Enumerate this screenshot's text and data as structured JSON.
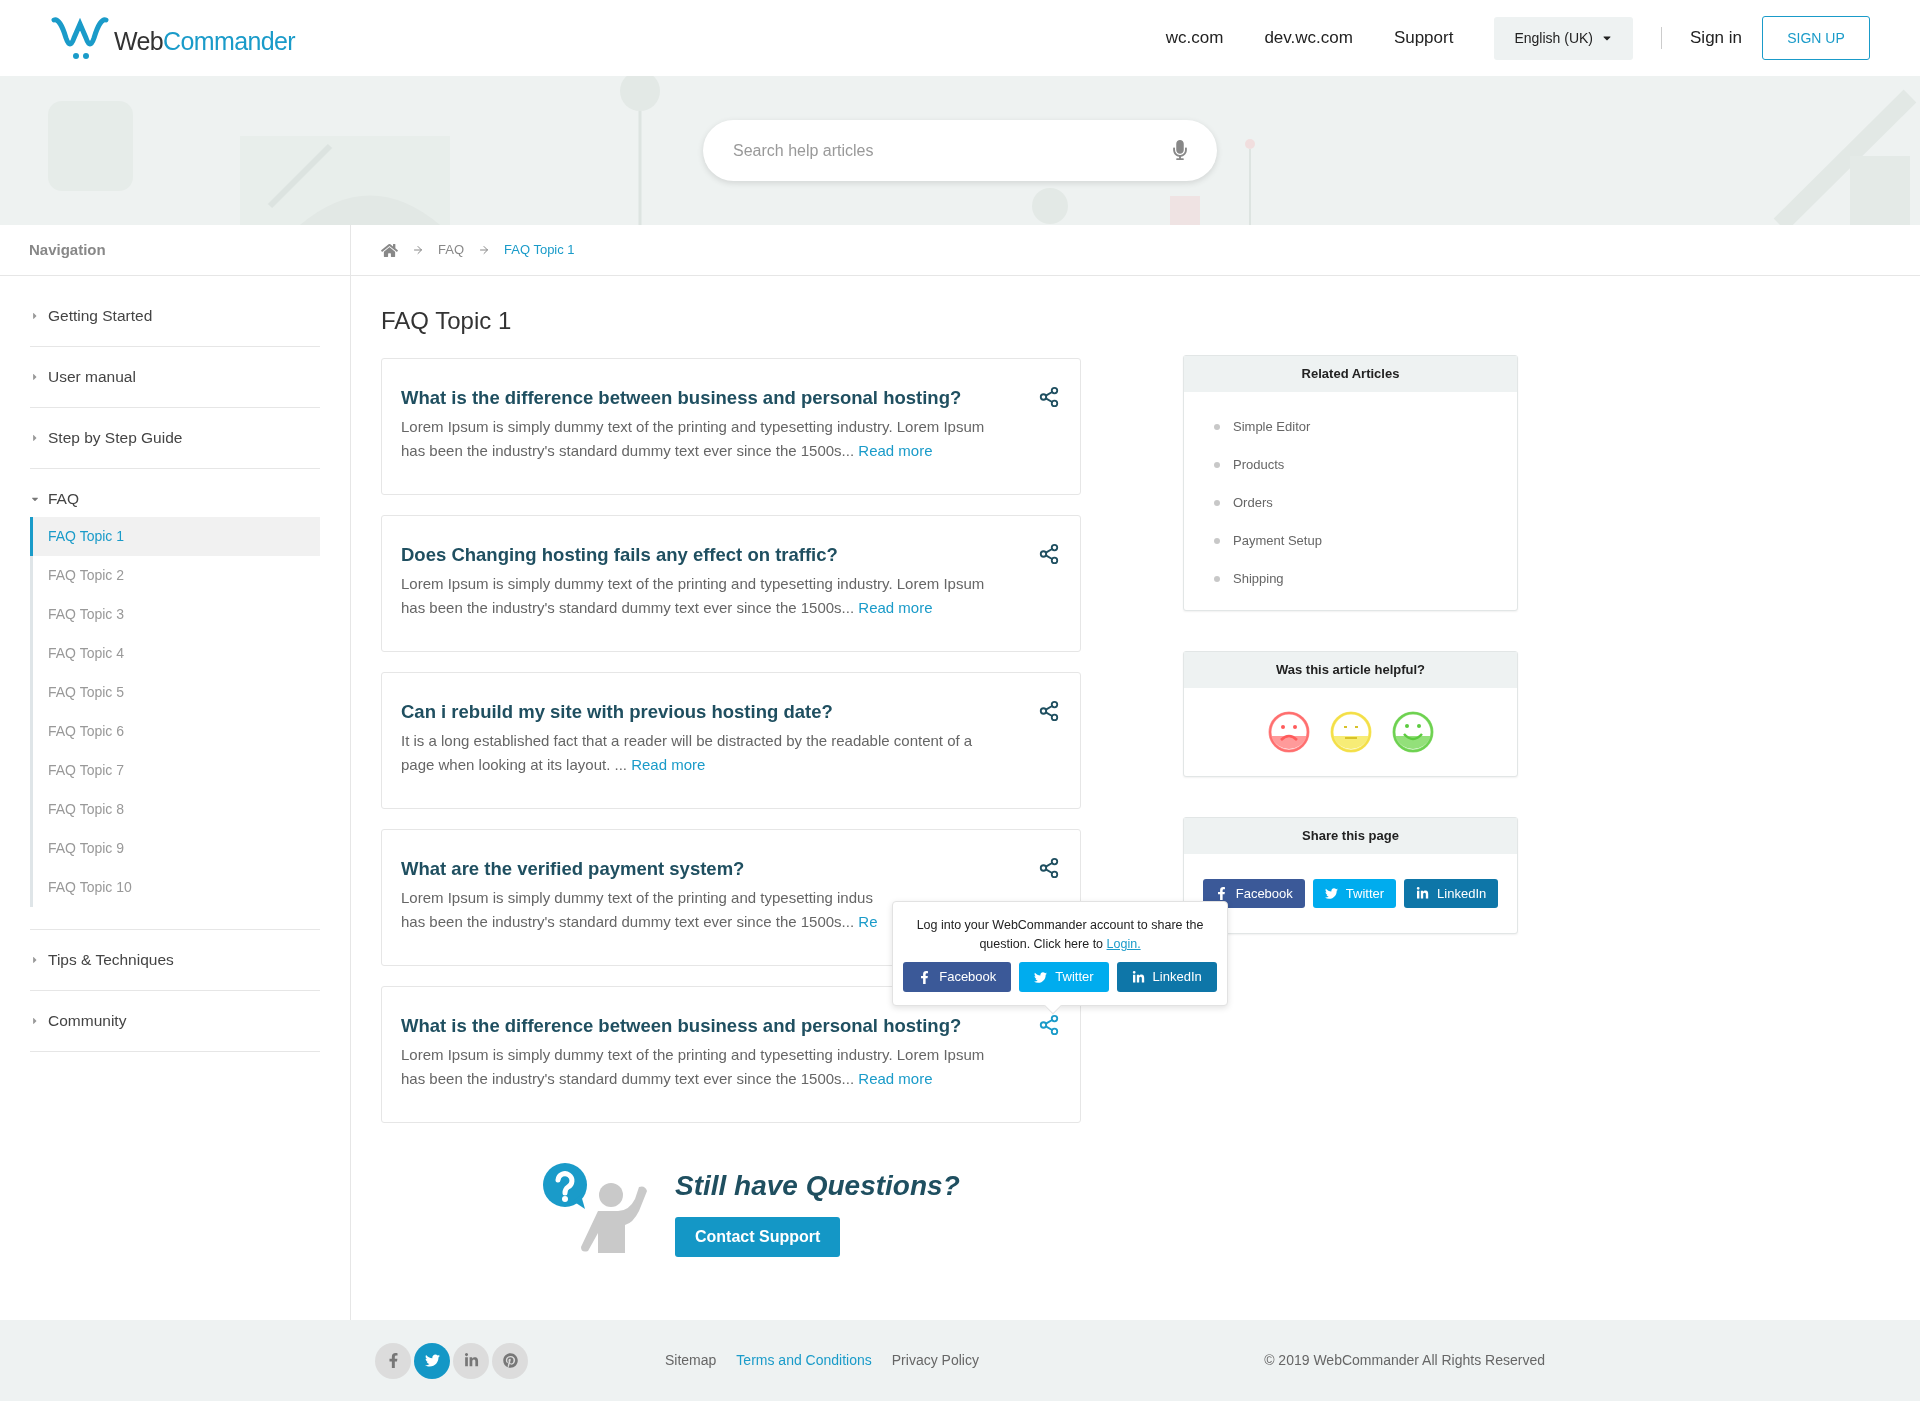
{
  "header": {
    "logo": {
      "part_1": "Web",
      "part_2": "Commander"
    },
    "links": [
      "wc.com",
      "dev.wc.com",
      "Support"
    ],
    "language": "English (UK)",
    "sign_in": "Sign in",
    "sign_up": "SIGN UP"
  },
  "search": {
    "placeholder": "Search help articles"
  },
  "sidebar": {
    "title": "Navigation",
    "items": [
      {
        "label": "Getting Started",
        "expanded": false
      },
      {
        "label": "User manual",
        "expanded": false
      },
      {
        "label": "Step by Step Guide",
        "expanded": false
      },
      {
        "label": "FAQ",
        "expanded": true,
        "children": [
          {
            "label": "FAQ Topic 1",
            "selected": true
          },
          {
            "label": "FAQ Topic 2",
            "selected": false
          },
          {
            "label": "FAQ Topic 3",
            "selected": false
          },
          {
            "label": "FAQ Topic 4",
            "selected": false
          },
          {
            "label": "FAQ Topic 5",
            "selected": false
          },
          {
            "label": "FAQ Topic 6",
            "selected": false
          },
          {
            "label": "FAQ Topic 7",
            "selected": false
          },
          {
            "label": "FAQ Topic 8",
            "selected": false
          },
          {
            "label": "FAQ Topic 9",
            "selected": false
          },
          {
            "label": "FAQ Topic 10",
            "selected": false
          }
        ]
      },
      {
        "label": "Tips & Techniques",
        "expanded": false
      },
      {
        "label": "Community",
        "expanded": false
      }
    ]
  },
  "breadcrumb": [
    "FAQ",
    "FAQ Topic 1"
  ],
  "page_title": "FAQ Topic 1",
  "questions": [
    {
      "title": "What is the difference between business and personal hosting?",
      "lines": [
        "Lorem Ipsum is simply dummy text of the printing and typesetting industry. Lorem Ipsum has been the industry's standard dummy text ever since the 1500s..."
      ],
      "read_more": "Read more",
      "share_open": false
    },
    {
      "title": "Does Changing hosting fails any effect on traffic?",
      "lines": [
        "Lorem Ipsum is simply dummy text of the printing and typesetting industry. Lorem Ipsum has been the industry's standard dummy text ever since the 1500s..."
      ],
      "read_more": "Read more",
      "share_open": false
    },
    {
      "title": "Can i rebuild my site with previous hosting date?",
      "lines": [
        "It is a long established fact that a reader will be distracted by the readable content of a page when looking at its layout. ..."
      ],
      "read_more": "Read more",
      "share_open": false
    },
    {
      "title": "What are the verified payment system?",
      "lines": [
        "Lorem Ipsum is simply dummy text of the printing and typesetting indus",
        "has been the industry's standard dummy text ever since the 1500s..."
      ],
      "read_more": "Re",
      "share_open": false
    },
    {
      "title": "What is the difference between business and personal hosting?",
      "lines": [
        "Lorem Ipsum is simply dummy text of the printing and typesetting industry. Lorem Ipsum has been the industry's standard dummy text ever since the 1500s..."
      ],
      "read_more": "Read more",
      "share_open": true
    }
  ],
  "share_popover": {
    "message": "Log into your WebCommander account to share the question. Click here to",
    "login": "Login.",
    "buttons": [
      {
        "kind": "facebook",
        "label": "Facebook"
      },
      {
        "kind": "twitter",
        "label": "Twitter"
      },
      {
        "kind": "linkedin",
        "label": "LinkedIn"
      }
    ]
  },
  "related_articles": {
    "title": "Related Articles",
    "items": [
      "Simple Editor",
      "Products",
      "Orders",
      "Payment Setup",
      "Shipping"
    ]
  },
  "helpful": {
    "title": "Was this article helpful?"
  },
  "share_page": {
    "title": "Share this page",
    "buttons": [
      {
        "kind": "facebook",
        "label": "Facebook"
      },
      {
        "kind": "twitter",
        "label": "Twitter"
      },
      {
        "kind": "linkedin",
        "label": "LinkedIn"
      }
    ]
  },
  "still_questions": {
    "title": "Still have Questions?",
    "button": "Contact Support"
  },
  "footer": {
    "socials": [
      {
        "kind": "facebook",
        "selected": false
      },
      {
        "kind": "twitter",
        "selected": true
      },
      {
        "kind": "linkedin",
        "selected": false
      },
      {
        "kind": "pinterest",
        "selected": false
      }
    ],
    "links": [
      {
        "label": "Sitemap",
        "selected": false
      },
      {
        "label": "Terms and Conditions",
        "selected": true
      },
      {
        "label": "Privacy Policy",
        "selected": false
      }
    ],
    "copyright": "© 2019 WebCommander All Rights Reserved"
  }
}
